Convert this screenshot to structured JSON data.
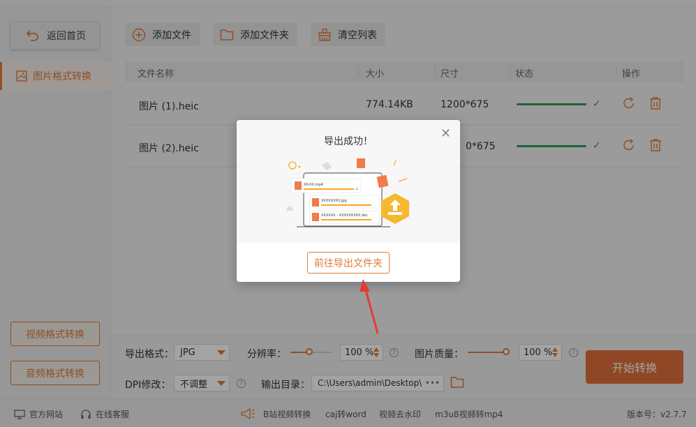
{
  "sidebar": {
    "home_label": "返回首页",
    "active_nav_label": "图片格式转换",
    "video_label": "视频格式转换",
    "audio_label": "音频格式转换"
  },
  "toolbar": {
    "add_file_label": "添加文件",
    "add_folder_label": "添加文件夹",
    "clear_label": "清空列表"
  },
  "table": {
    "columns": [
      "文件名称",
      "大小",
      "尺寸",
      "状态",
      "操作"
    ],
    "rows": [
      {
        "name": "图片 (1).heic",
        "size": "774.14KB",
        "dimensions": "1200*675",
        "progress": 1.0
      },
      {
        "name": "图片 (2).heic",
        "size": "",
        "dimensions": "0*675",
        "progress": 1.0
      }
    ]
  },
  "settings": {
    "format_label": "导出格式：",
    "format_value": "JPG",
    "resolution_label": "分辨率：",
    "resolution_value": "100 %",
    "quality_label": "图片质量：",
    "quality_value": "100 %",
    "dpi_label": "DPI修改：",
    "dpi_value": "不调整",
    "output_label": "输出目录：",
    "output_value": "C:\\Users\\admin\\Desktop\\",
    "more_label": "•••",
    "start_label": "开始转换"
  },
  "footer": {
    "website": "官方网站",
    "support": "在线客服",
    "link1": "B站视频转换",
    "link2": "caj转word",
    "link3": "视频去水印",
    "link4": "m3u8视频转mp4",
    "version": "版本号：v2.7.7"
  },
  "modal": {
    "title": "导出成功！",
    "button_label": "前往导出文件夹",
    "illustration_items": [
      "XX-XX.mp4",
      "XXXXXXXX.jpg",
      "XXXXXX - XXXXXXXXX.doc"
    ]
  },
  "colors": {
    "accent": "#e07a38",
    "success": "#2e9c5c",
    "start_button": "#e2703a"
  }
}
